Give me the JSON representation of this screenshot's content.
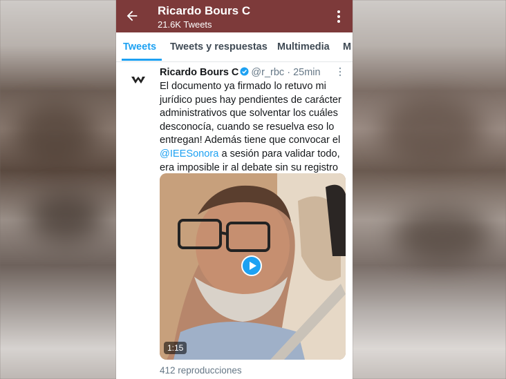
{
  "header": {
    "title": "Ricardo Bours C",
    "subtitle": "21.6K Tweets",
    "back_icon": "arrow-left-icon",
    "menu_icon": "more-vertical-icon"
  },
  "tabs": [
    {
      "label": "Tweets",
      "active": true
    },
    {
      "label": "Tweets y respuestas",
      "active": false
    },
    {
      "label": "Multimedia",
      "active": false
    },
    {
      "label": "M",
      "active": false
    }
  ],
  "tweet": {
    "name": "Ricardo Bours C",
    "handle": "@r_rbc",
    "time": "· 25min",
    "text_before": "El documento ya firmado lo retuvo mi jurídico pues hay pendientes de carácter administrativos que solventar los cuáles desconocía, cuando se resuelva eso lo entregan! Además tiene que convocar el",
    "mention": "@IEESonora",
    "text_after": "a sesión para validar todo, era imposible ir al debate sin su registro",
    "video_duration": "1:15",
    "views": "412 reproducciones"
  },
  "colors": {
    "appbar": "#7d3a3a",
    "accent": "#1da1f2"
  }
}
